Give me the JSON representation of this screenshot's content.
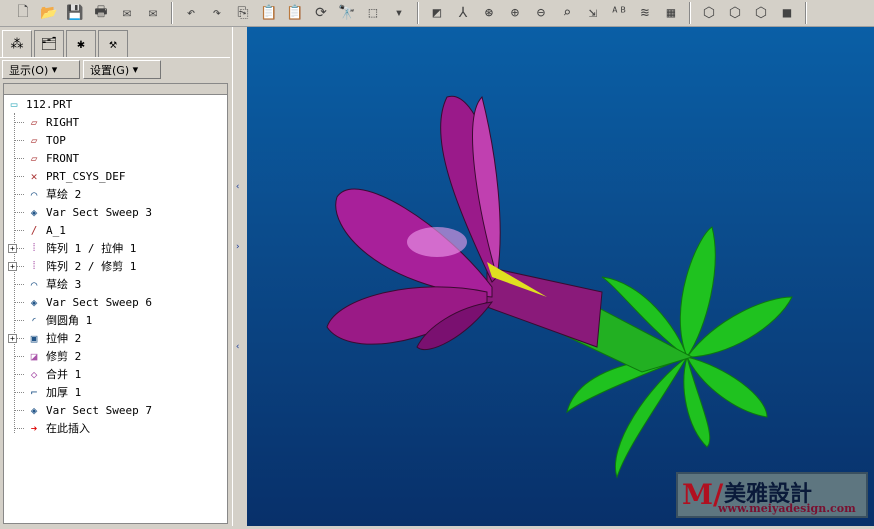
{
  "toolbar": {
    "icons": [
      "new-icon",
      "open-icon",
      "save-icon",
      "print-icon",
      "email-icon",
      "email-link-icon",
      "undo-icon",
      "redo-icon",
      "copy-icon",
      "paste-icon",
      "paste-special-icon",
      "regenerate-icon",
      "find-icon",
      "select-box-icon",
      "dropdown-icon",
      "datum-display-icon",
      "csys-icon",
      "spin-center-icon",
      "zoom-in-icon",
      "zoom-out-icon",
      "refit-icon",
      "orient-icon",
      "annotation-icon",
      "layers-icon",
      "view-manager-icon",
      "wireframe-icon",
      "hidden-line-icon",
      "no-hidden-icon",
      "shading-icon"
    ]
  },
  "left_panel": {
    "menus": {
      "show": "显示(O)",
      "settings": "设置(G)"
    },
    "tree": [
      {
        "label": "112.PRT",
        "icon": "part-icon"
      },
      {
        "label": "RIGHT",
        "icon": "datum-plane-icon"
      },
      {
        "label": "TOP",
        "icon": "datum-plane-icon"
      },
      {
        "label": "FRONT",
        "icon": "datum-plane-icon"
      },
      {
        "label": "PRT_CSYS_DEF",
        "icon": "csys-icon"
      },
      {
        "label": "草绘 2",
        "icon": "sketch-icon"
      },
      {
        "label": "Var Sect Sweep 3",
        "icon": "sweep-icon"
      },
      {
        "label": "A_1",
        "icon": "axis-icon"
      },
      {
        "label": "阵列 1 / 拉伸 1",
        "icon": "pattern-icon",
        "expandable": true
      },
      {
        "label": "阵列 2 / 修剪 1",
        "icon": "pattern-icon",
        "expandable": true
      },
      {
        "label": "草绘 3",
        "icon": "sketch-icon"
      },
      {
        "label": "Var Sect Sweep 6",
        "icon": "sweep-icon"
      },
      {
        "label": "倒圆角 1",
        "icon": "round-icon"
      },
      {
        "label": "拉伸 2",
        "icon": "extrude-icon",
        "expandable": true
      },
      {
        "label": "修剪 2",
        "icon": "trim-icon"
      },
      {
        "label": "合并 1",
        "icon": "merge-icon"
      },
      {
        "label": "加厚 1",
        "icon": "thicken-icon"
      },
      {
        "label": "Var Sect Sweep 7",
        "icon": "sweep-icon"
      },
      {
        "label": "在此插入",
        "icon": "insert-here-arrow-icon"
      }
    ]
  },
  "watermark": {
    "title": "美雅設計",
    "url": "www.meiyadesign.com"
  },
  "colors": {
    "petal": "#9a1a86",
    "leaf": "#1fc21f",
    "background": "#0b4a8a"
  }
}
